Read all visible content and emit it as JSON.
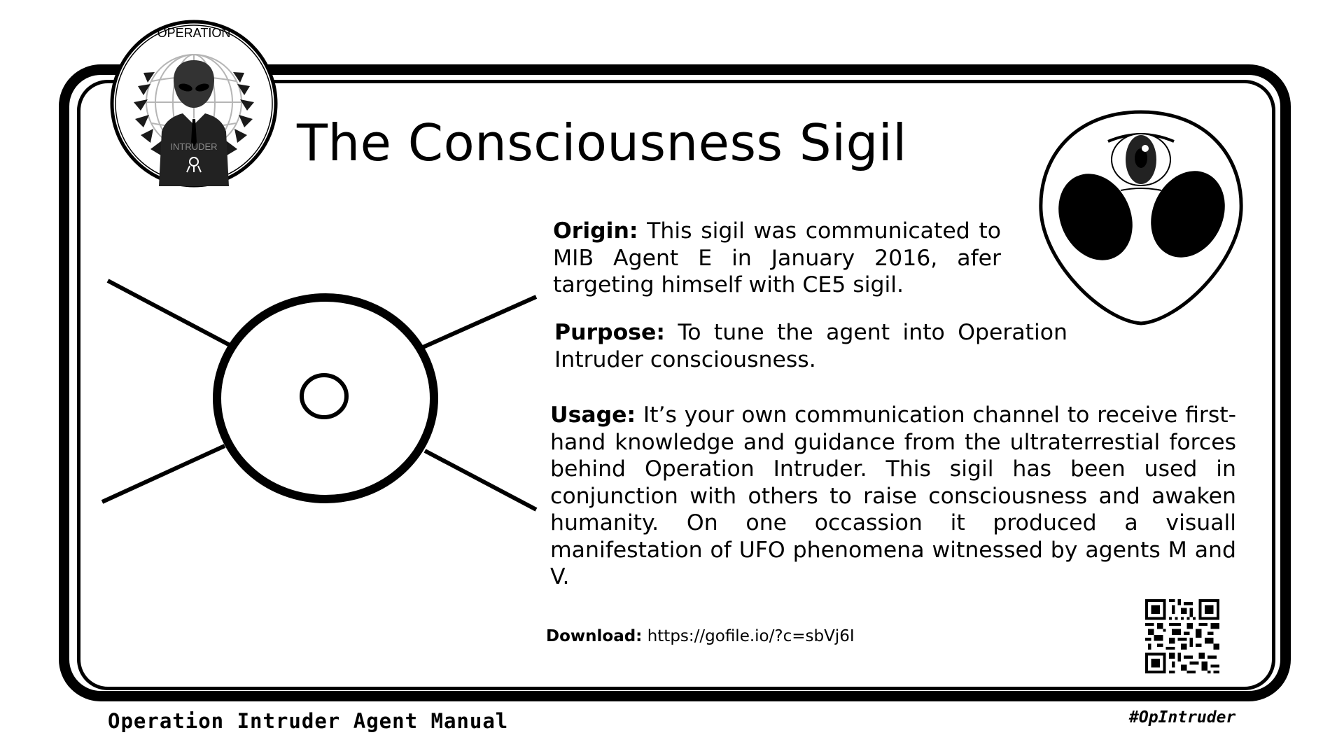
{
  "card": {
    "title": "The Consciousness Sigil",
    "origin": {
      "label": "Origin:",
      "text": "This sigil was communicated to MIB Agent E in January 2016, afer targeting himself with CE5 sigil."
    },
    "purpose": {
      "label": "Purpose:",
      "text": "To tune the agent into Operation Intruder consciousness."
    },
    "usage": {
      "label": "Usage:",
      "text": "It’s your own communication channel to receive first-hand knowledge and guidance from the ultraterrestial forces behind Operation Intruder. This sigil has been used in conjunction with others to raise consciousness and awaken humanity. On one occassion it produced a visuall manifestation of UFO phenomena witnessed by agents M and V."
    },
    "download": {
      "label": "Download:",
      "url": "https://gofile.io/?c=sbVj6I"
    }
  },
  "emblem": {
    "top_text": "OPERATION",
    "bottom_text": "INTRUDER"
  },
  "footer": {
    "left": "Operation Intruder Agent Manual",
    "right": "#OpIntruder"
  },
  "icons": {
    "emblem": "operation-intruder-emblem-icon",
    "alien_head": "alien-head-icon",
    "sigil": "consciousness-sigil-icon",
    "qr": "qr-code-icon"
  },
  "colors": {
    "ink": "#000000",
    "paper": "#ffffff",
    "emblem_gray": "#8a8a8a"
  }
}
